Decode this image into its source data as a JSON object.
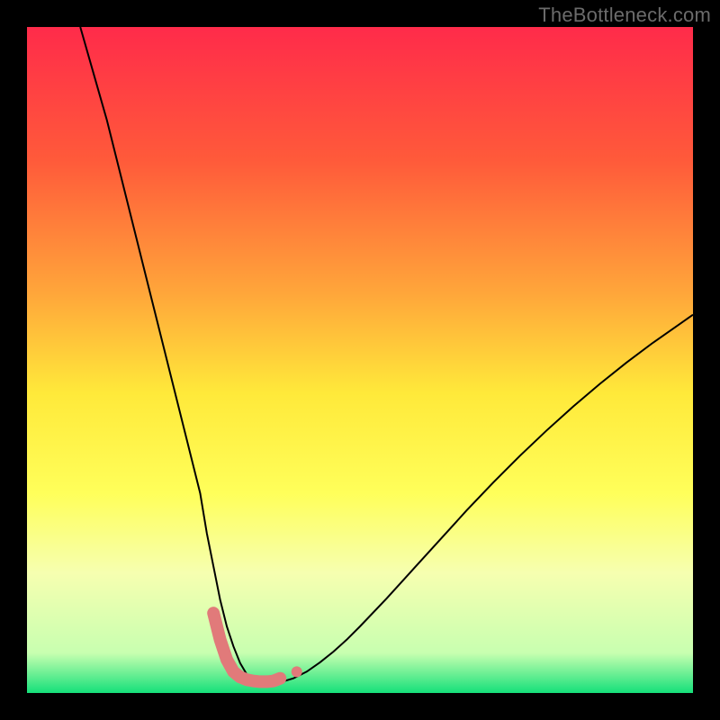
{
  "watermark": "TheBottleneck.com",
  "chart_data": {
    "type": "line",
    "title": "",
    "xlabel": "",
    "ylabel": "",
    "xlim": [
      0,
      100
    ],
    "ylim": [
      0,
      100
    ],
    "background_gradient": {
      "stops": [
        {
          "offset": 0.0,
          "color": "#ff2b4a"
        },
        {
          "offset": 0.2,
          "color": "#ff5a3a"
        },
        {
          "offset": 0.4,
          "color": "#ffa63a"
        },
        {
          "offset": 0.55,
          "color": "#ffe93a"
        },
        {
          "offset": 0.7,
          "color": "#ffff5a"
        },
        {
          "offset": 0.82,
          "color": "#f6ffb0"
        },
        {
          "offset": 0.94,
          "color": "#c8ffb0"
        },
        {
          "offset": 1.0,
          "color": "#15e07a"
        }
      ]
    },
    "series": [
      {
        "name": "bottleneck-curve",
        "color": "#000000",
        "stroke_width": 2.0,
        "x": [
          8,
          10,
          12,
          14,
          16,
          18,
          20,
          22,
          24,
          26,
          27,
          28,
          29,
          30,
          31,
          32,
          33,
          34,
          35,
          36,
          37,
          38,
          40,
          42,
          44,
          46,
          48,
          50,
          54,
          58,
          62,
          66,
          70,
          74,
          78,
          82,
          86,
          90,
          94,
          98,
          100
        ],
        "y": [
          100,
          93,
          86,
          78,
          70,
          62,
          54,
          46,
          38,
          30,
          24,
          19,
          14,
          10,
          7,
          4.5,
          2.8,
          2.0,
          1.6,
          1.5,
          1.5,
          1.6,
          2.2,
          3.2,
          4.6,
          6.2,
          8.0,
          10.0,
          14.2,
          18.6,
          23.0,
          27.4,
          31.6,
          35.6,
          39.4,
          43.0,
          46.4,
          49.6,
          52.6,
          55.4,
          56.8
        ]
      },
      {
        "name": "optimal-band",
        "color": "#e17a7a",
        "stroke_width": 14,
        "linecap": "round",
        "x": [
          28,
          29,
          30,
          31,
          32,
          33,
          34,
          35,
          36,
          37,
          38
        ],
        "y": [
          12,
          8,
          5,
          3.2,
          2.4,
          2.0,
          1.8,
          1.7,
          1.7,
          1.8,
          2.2
        ]
      }
    ],
    "markers": [
      {
        "name": "marker-right",
        "x": 40.5,
        "y": 3.2,
        "r": 6,
        "color": "#e17a7a"
      }
    ]
  },
  "colors": {
    "frame": "#000000",
    "watermark": "#6b6b6b"
  }
}
